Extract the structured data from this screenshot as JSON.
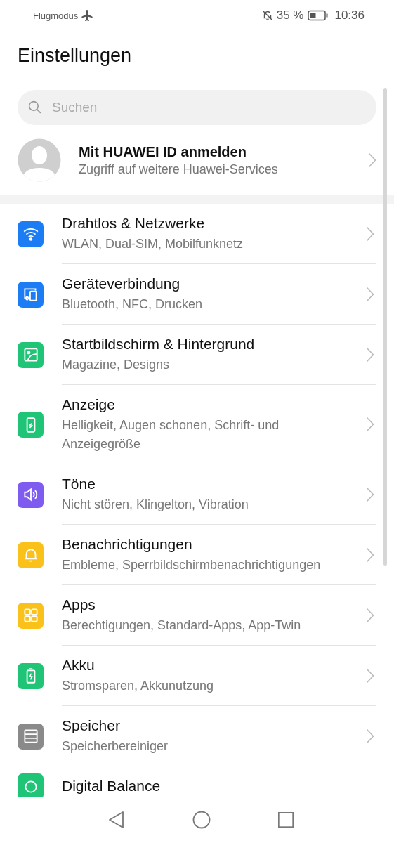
{
  "status_bar": {
    "mode": "Flugmodus",
    "battery": "35 %",
    "time": "10:36"
  },
  "title": "Einstellungen",
  "search": {
    "placeholder": "Suchen"
  },
  "account": {
    "title": "Mit HUAWEI ID anmelden",
    "subtitle": "Zugriff auf weitere Huawei-Services"
  },
  "rows": [
    {
      "color": "#1b7cf4",
      "title": "Drahtlos & Netzwerke",
      "subtitle": "WLAN, Dual-SIM, Mobilfunknetz"
    },
    {
      "color": "#1b7cf4",
      "title": "Geräteverbindung",
      "subtitle": "Bluetooth, NFC, Drucken"
    },
    {
      "color": "#1fc476",
      "title": "Startbildschirm & Hintergrund",
      "subtitle": "Magazine, Designs"
    },
    {
      "color": "#1fc476",
      "title": "Anzeige",
      "subtitle": "Helligkeit, Augen schonen, Schrift- und Anzeigegröße"
    },
    {
      "color": "#7f5cf0",
      "title": "Töne",
      "subtitle": "Nicht stören, Klingelton, Vibration"
    },
    {
      "color": "#fbc11b",
      "title": "Benachrichtigungen",
      "subtitle": "Embleme, Sperrbildschirmbenachrichtigungen"
    },
    {
      "color": "#fbc11b",
      "title": "Apps",
      "subtitle": "Berechtigungen, Standard-Apps, App-Twin"
    },
    {
      "color": "#1fc476",
      "title": "Akku",
      "subtitle": "Stromsparen, Akkunutzung"
    },
    {
      "color": "#8a8a8a",
      "title": "Speicher",
      "subtitle": "Speicherbereiniger"
    },
    {
      "color": "#1fc476",
      "title": "Digital Balance"
    }
  ]
}
